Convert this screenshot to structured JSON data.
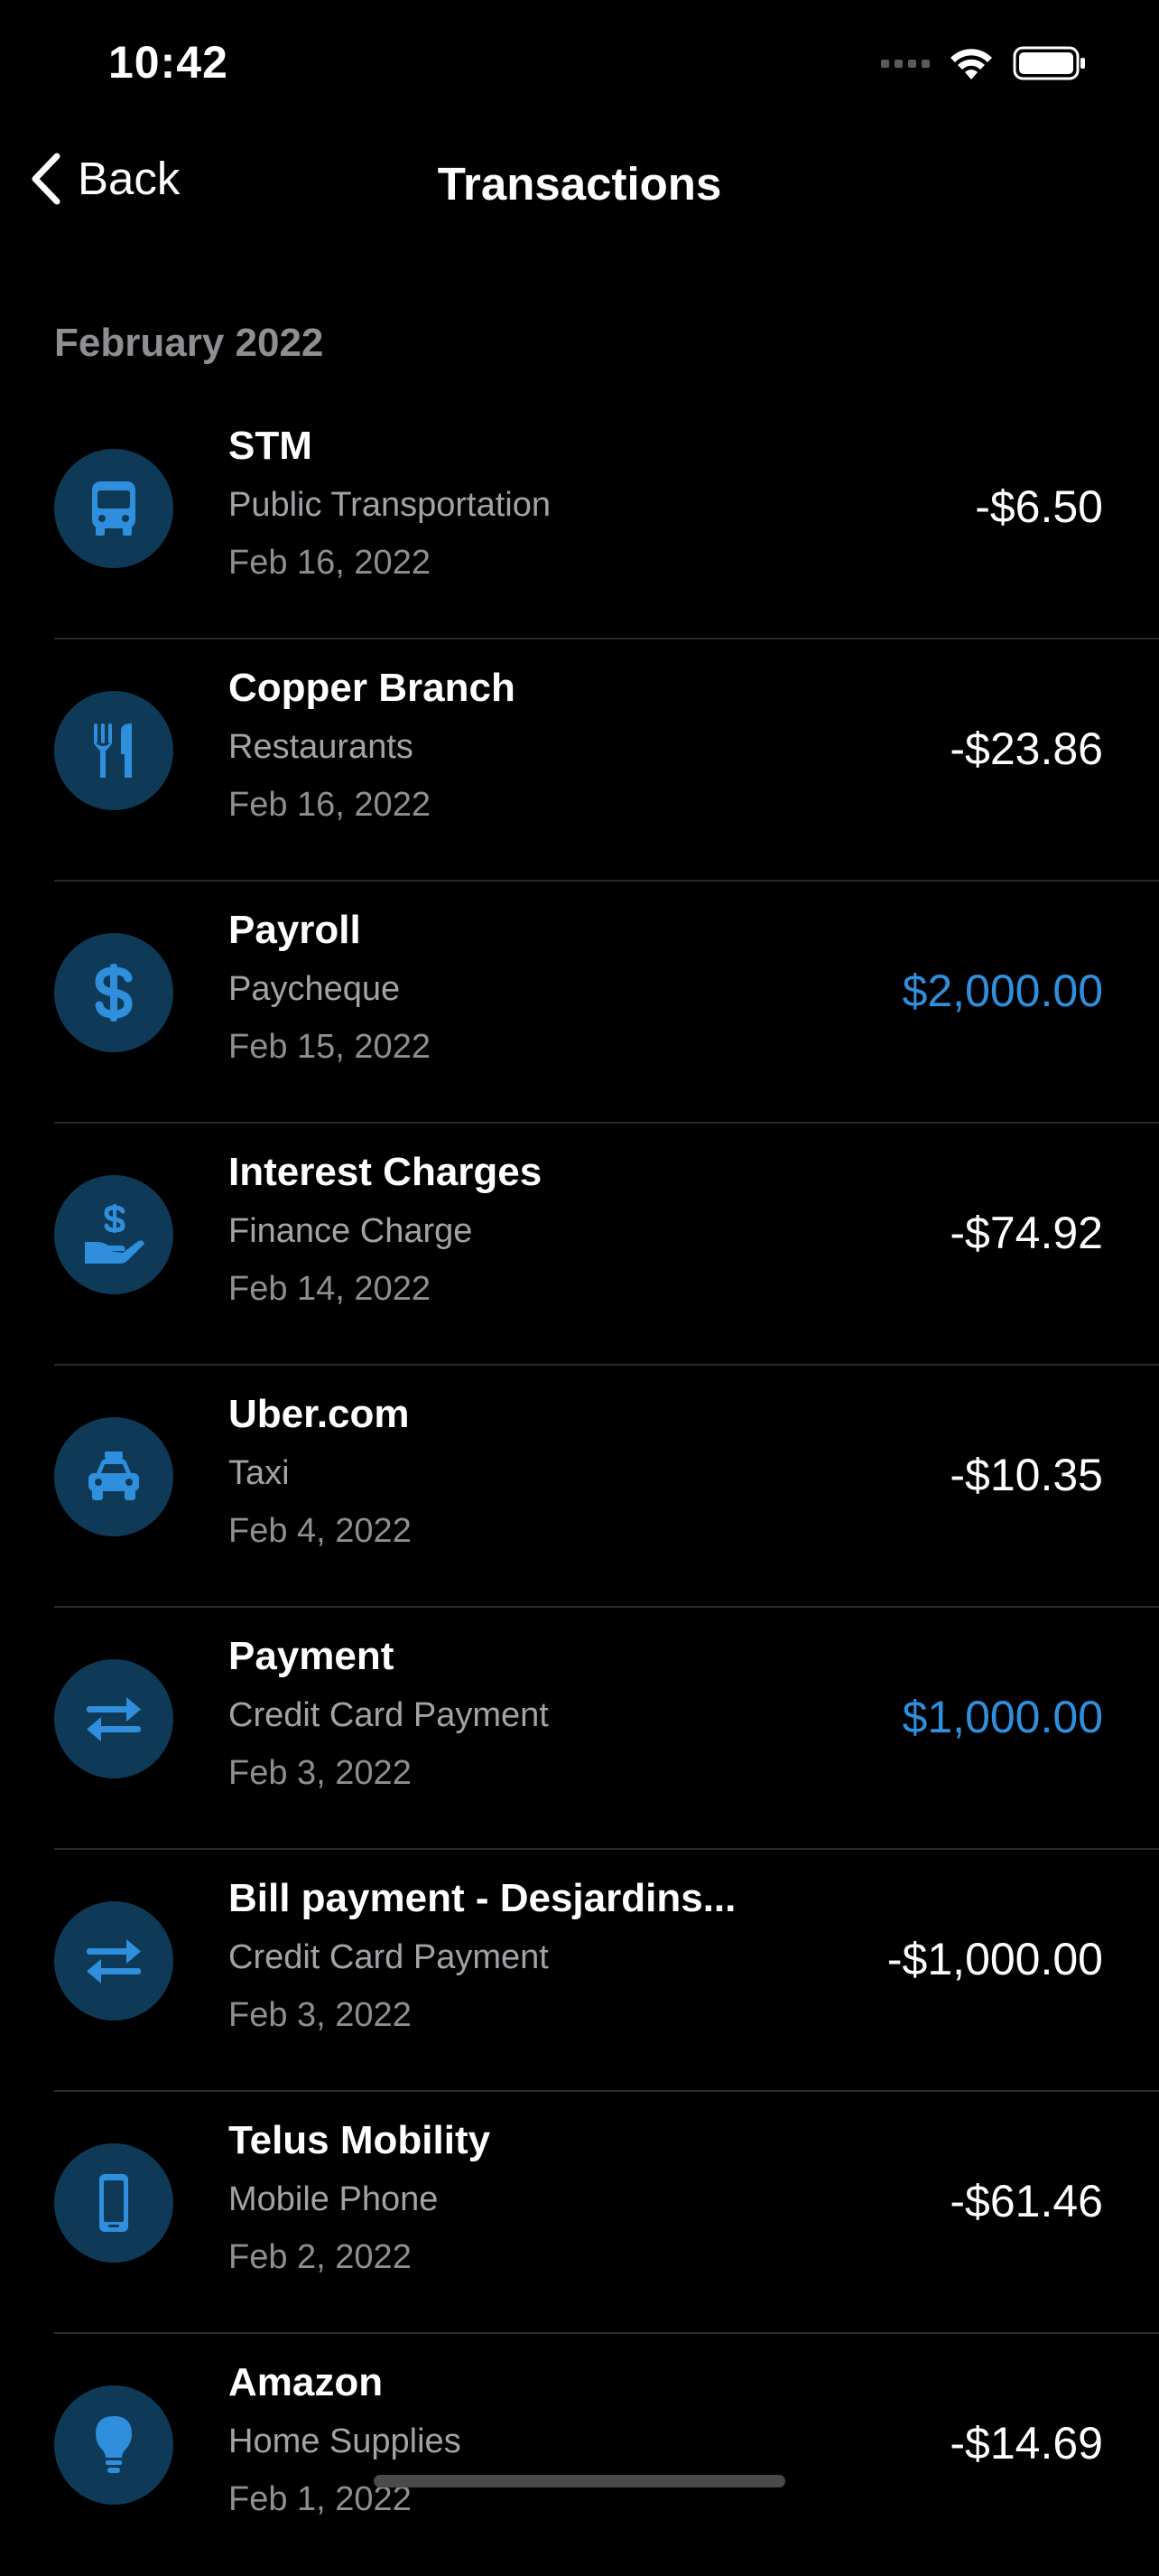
{
  "status_bar": {
    "time": "10:42"
  },
  "nav": {
    "back_label": "Back",
    "title": "Transactions"
  },
  "section": {
    "header": "February 2022"
  },
  "colors": {
    "accent": "#2f8fdc",
    "icon_bg": "#0e3a57",
    "background": "#000000"
  },
  "transactions": [
    {
      "merchant": "STM",
      "category": "Public Transportation",
      "date": "Feb 16, 2022",
      "amount": "-$6.50",
      "icon": "bus-icon",
      "credit": false
    },
    {
      "merchant": "Copper Branch",
      "category": "Restaurants",
      "date": "Feb 16, 2022",
      "amount": "-$23.86",
      "icon": "fork-knife-icon",
      "credit": false
    },
    {
      "merchant": "Payroll",
      "category": "Paycheque",
      "date": "Feb 15, 2022",
      "amount": "$2,000.00",
      "icon": "dollar-icon",
      "credit": true
    },
    {
      "merchant": "Interest Charges",
      "category": "Finance Charge",
      "date": "Feb 14, 2022",
      "amount": "-$74.92",
      "icon": "hand-dollar-icon",
      "credit": false
    },
    {
      "merchant": "Uber.com",
      "category": "Taxi",
      "date": "Feb 4, 2022",
      "amount": "-$10.35",
      "icon": "car-icon",
      "credit": false
    },
    {
      "merchant": "Payment",
      "category": "Credit Card Payment",
      "date": "Feb 3, 2022",
      "amount": "$1,000.00",
      "icon": "transfer-arrows-icon",
      "credit": true
    },
    {
      "merchant": "Bill payment - Desjardins...",
      "category": "Credit Card Payment",
      "date": "Feb 3, 2022",
      "amount": "-$1,000.00",
      "icon": "transfer-arrows-icon",
      "credit": false
    },
    {
      "merchant": "Telus Mobility",
      "category": "Mobile Phone",
      "date": "Feb 2, 2022",
      "amount": "-$61.46",
      "icon": "phone-icon",
      "credit": false
    },
    {
      "merchant": "Amazon",
      "category": "Home Supplies",
      "date": "Feb 1, 2022",
      "amount": "-$14.69",
      "icon": "lightbulb-icon",
      "credit": false
    }
  ]
}
